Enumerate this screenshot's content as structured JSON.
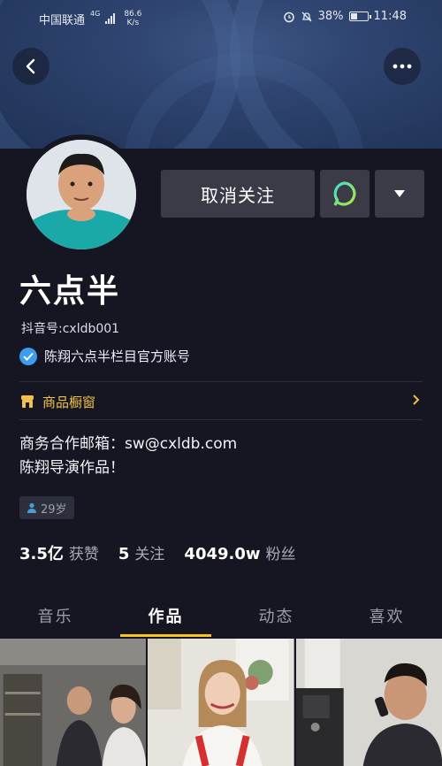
{
  "status_bar": {
    "carrier": "中国联通",
    "network": "4G",
    "speed_value": "86.6",
    "speed_unit": "K/s",
    "battery": "38%",
    "time": "11:48"
  },
  "profile": {
    "name": "六点半",
    "douyin_id": "抖音号:cxldb001",
    "verification": "陈翔六点半栏目官方账号",
    "unfollow_label": "取消关注"
  },
  "shop": {
    "label": "商品橱窗"
  },
  "bio": {
    "line1": "商务合作邮箱：sw@cxldb.com",
    "line2": "陈翔导演作品！"
  },
  "age_tag": "29岁",
  "stats": {
    "likes_value": "3.5亿",
    "likes_label": "获赞",
    "following_value": "5",
    "following_label": "关注",
    "followers_value": "4049.0w",
    "followers_label": "粉丝"
  },
  "tabs": [
    "音乐",
    "作品",
    "动态",
    "喜欢"
  ],
  "active_tab": "作品",
  "colors": {
    "accent": "#f9c21d",
    "verify": "#3b9cf0",
    "background": "#161622",
    "shop": "#f0c14a"
  }
}
